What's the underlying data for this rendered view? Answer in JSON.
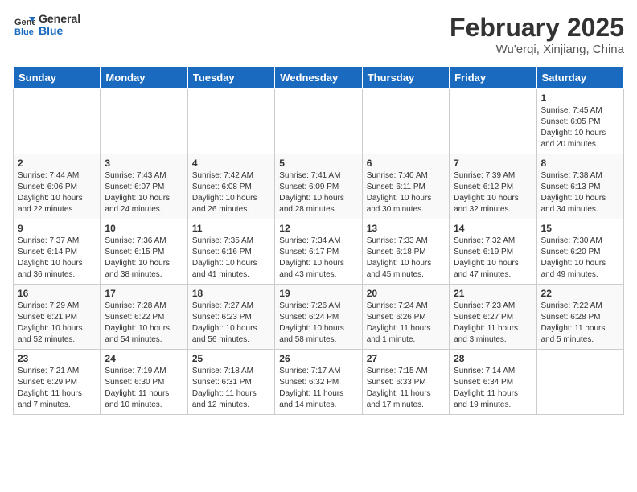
{
  "header": {
    "logo_line1": "General",
    "logo_line2": "Blue",
    "month_title": "February 2025",
    "location": "Wu'erqi, Xinjiang, China"
  },
  "weekdays": [
    "Sunday",
    "Monday",
    "Tuesday",
    "Wednesday",
    "Thursday",
    "Friday",
    "Saturday"
  ],
  "weeks": [
    [
      {
        "day": "",
        "info": ""
      },
      {
        "day": "",
        "info": ""
      },
      {
        "day": "",
        "info": ""
      },
      {
        "day": "",
        "info": ""
      },
      {
        "day": "",
        "info": ""
      },
      {
        "day": "",
        "info": ""
      },
      {
        "day": "1",
        "info": "Sunrise: 7:45 AM\nSunset: 6:05 PM\nDaylight: 10 hours and 20 minutes."
      }
    ],
    [
      {
        "day": "2",
        "info": "Sunrise: 7:44 AM\nSunset: 6:06 PM\nDaylight: 10 hours and 22 minutes."
      },
      {
        "day": "3",
        "info": "Sunrise: 7:43 AM\nSunset: 6:07 PM\nDaylight: 10 hours and 24 minutes."
      },
      {
        "day": "4",
        "info": "Sunrise: 7:42 AM\nSunset: 6:08 PM\nDaylight: 10 hours and 26 minutes."
      },
      {
        "day": "5",
        "info": "Sunrise: 7:41 AM\nSunset: 6:09 PM\nDaylight: 10 hours and 28 minutes."
      },
      {
        "day": "6",
        "info": "Sunrise: 7:40 AM\nSunset: 6:11 PM\nDaylight: 10 hours and 30 minutes."
      },
      {
        "day": "7",
        "info": "Sunrise: 7:39 AM\nSunset: 6:12 PM\nDaylight: 10 hours and 32 minutes."
      },
      {
        "day": "8",
        "info": "Sunrise: 7:38 AM\nSunset: 6:13 PM\nDaylight: 10 hours and 34 minutes."
      }
    ],
    [
      {
        "day": "9",
        "info": "Sunrise: 7:37 AM\nSunset: 6:14 PM\nDaylight: 10 hours and 36 minutes."
      },
      {
        "day": "10",
        "info": "Sunrise: 7:36 AM\nSunset: 6:15 PM\nDaylight: 10 hours and 38 minutes."
      },
      {
        "day": "11",
        "info": "Sunrise: 7:35 AM\nSunset: 6:16 PM\nDaylight: 10 hours and 41 minutes."
      },
      {
        "day": "12",
        "info": "Sunrise: 7:34 AM\nSunset: 6:17 PM\nDaylight: 10 hours and 43 minutes."
      },
      {
        "day": "13",
        "info": "Sunrise: 7:33 AM\nSunset: 6:18 PM\nDaylight: 10 hours and 45 minutes."
      },
      {
        "day": "14",
        "info": "Sunrise: 7:32 AM\nSunset: 6:19 PM\nDaylight: 10 hours and 47 minutes."
      },
      {
        "day": "15",
        "info": "Sunrise: 7:30 AM\nSunset: 6:20 PM\nDaylight: 10 hours and 49 minutes."
      }
    ],
    [
      {
        "day": "16",
        "info": "Sunrise: 7:29 AM\nSunset: 6:21 PM\nDaylight: 10 hours and 52 minutes."
      },
      {
        "day": "17",
        "info": "Sunrise: 7:28 AM\nSunset: 6:22 PM\nDaylight: 10 hours and 54 minutes."
      },
      {
        "day": "18",
        "info": "Sunrise: 7:27 AM\nSunset: 6:23 PM\nDaylight: 10 hours and 56 minutes."
      },
      {
        "day": "19",
        "info": "Sunrise: 7:26 AM\nSunset: 6:24 PM\nDaylight: 10 hours and 58 minutes."
      },
      {
        "day": "20",
        "info": "Sunrise: 7:24 AM\nSunset: 6:26 PM\nDaylight: 11 hours and 1 minute."
      },
      {
        "day": "21",
        "info": "Sunrise: 7:23 AM\nSunset: 6:27 PM\nDaylight: 11 hours and 3 minutes."
      },
      {
        "day": "22",
        "info": "Sunrise: 7:22 AM\nSunset: 6:28 PM\nDaylight: 11 hours and 5 minutes."
      }
    ],
    [
      {
        "day": "23",
        "info": "Sunrise: 7:21 AM\nSunset: 6:29 PM\nDaylight: 11 hours and 7 minutes."
      },
      {
        "day": "24",
        "info": "Sunrise: 7:19 AM\nSunset: 6:30 PM\nDaylight: 11 hours and 10 minutes."
      },
      {
        "day": "25",
        "info": "Sunrise: 7:18 AM\nSunset: 6:31 PM\nDaylight: 11 hours and 12 minutes."
      },
      {
        "day": "26",
        "info": "Sunrise: 7:17 AM\nSunset: 6:32 PM\nDaylight: 11 hours and 14 minutes."
      },
      {
        "day": "27",
        "info": "Sunrise: 7:15 AM\nSunset: 6:33 PM\nDaylight: 11 hours and 17 minutes."
      },
      {
        "day": "28",
        "info": "Sunrise: 7:14 AM\nSunset: 6:34 PM\nDaylight: 11 hours and 19 minutes."
      },
      {
        "day": "",
        "info": ""
      }
    ]
  ]
}
